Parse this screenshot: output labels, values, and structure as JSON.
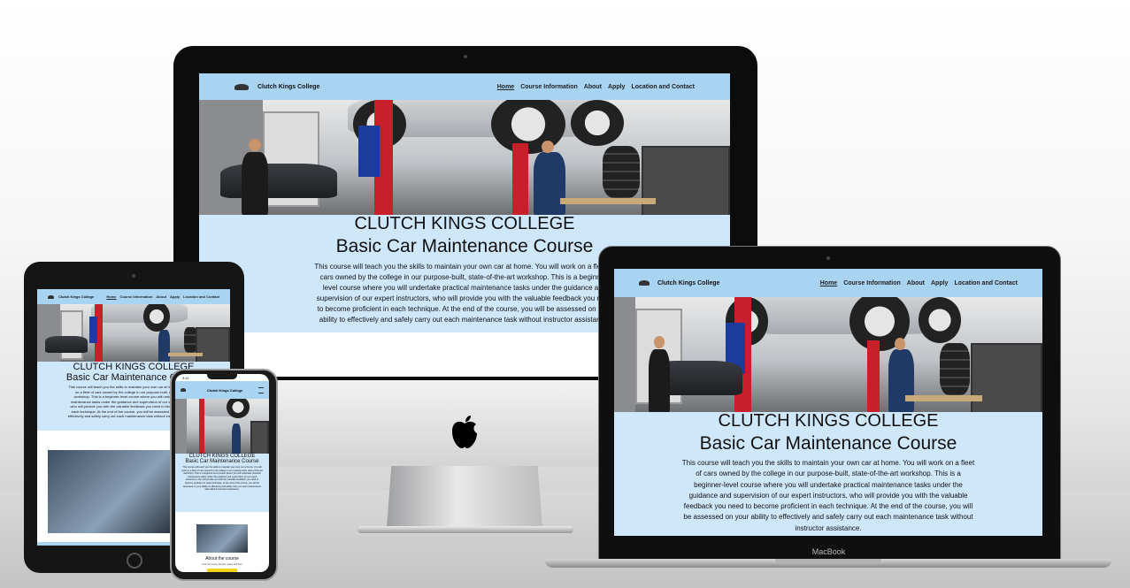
{
  "site": {
    "brand": "Clutch Kings College",
    "nav": [
      "Home",
      "Course Information",
      "About",
      "Apply",
      "Location and Contact"
    ],
    "heading": "CLUTCH KINGS COLLEGE",
    "subheading": "Basic Car Maintenance Course",
    "intro": "This course will teach you the skills to maintain your own car at home. You will work on a fleet of cars owned by the college in our purpose-built, state-of-the-art workshop. This is a beginner-level course where you will undertake practical maintenance tasks under the guidance and supervision of our expert instructors, who will provide you with the valuable feedback you need to become proficient in each technique. At the end of the course, you will be assessed on your ability to effectively and safely carry out each maintenance task without instructor assistance.",
    "about_title": "About the course",
    "about_sub": "Find out course content, dates and fees"
  },
  "phone": {
    "time": "9:41"
  },
  "laptop": {
    "label": "MacBook"
  },
  "colors": {
    "nav_bg": "#a8d4f2",
    "intro_bg": "#cfe7fa",
    "accent": "#c8202b"
  }
}
